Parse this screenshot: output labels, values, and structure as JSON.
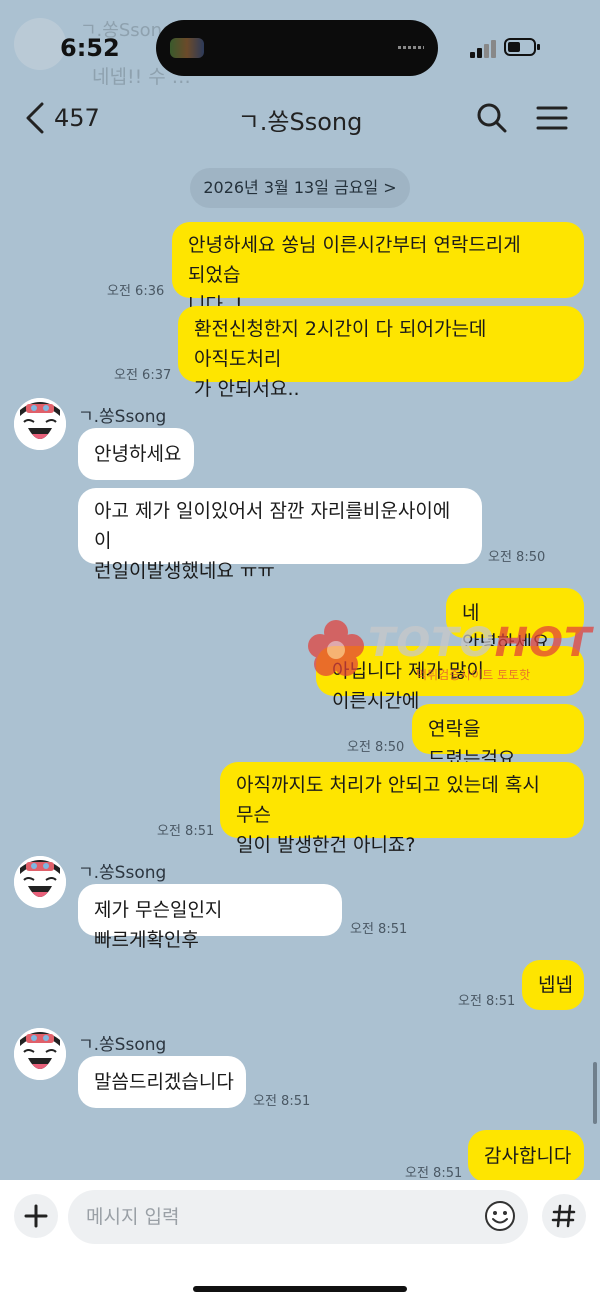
{
  "status": {
    "time": "6:52",
    "banner_sender": "ㄱ.쏭Ssong",
    "banner_preview": "네넵!! 수 …"
  },
  "header": {
    "unread_count": "457",
    "title": "ㄱ.쏭Ssong"
  },
  "date_chip": "2026년 3월 13일 금요일 >",
  "messages": [
    {
      "side": "me",
      "lines": [
        "안녕하세요 쏭님 이른시간부터 연락드리게 되었습",
        "니다..!"
      ],
      "time": "오전 6:36"
    },
    {
      "side": "me",
      "lines": [
        "환전신청한지 2시간이 다 되어가는데 아직도처리",
        "가 안되서요.."
      ],
      "time": "오전 6:37"
    },
    {
      "side": "them",
      "sender": "ㄱ.쏭Ssong",
      "lines": [
        "안녕하세요"
      ]
    },
    {
      "side": "them",
      "lines": [
        "아고  제가 일이있어서 잠깐 자리를비운사이에 이",
        "런일이발생했네요 ㅠㅠ"
      ],
      "time": "오전 8:50"
    },
    {
      "side": "me",
      "lines": [
        "네 안녕하세요"
      ]
    },
    {
      "side": "me",
      "lines": [
        "아닙니다 제가 많이 이른시간에"
      ]
    },
    {
      "side": "me",
      "lines": [
        "연락을 드렸는걸요"
      ],
      "time": "오전 8:50"
    },
    {
      "side": "me",
      "lines": [
        "아직까지도 처리가 안되고 있는데 혹시 무슨",
        "일이 발생한건 아니죠?"
      ],
      "time": "오전 8:51"
    },
    {
      "side": "them",
      "sender": "ㄱ.쏭Ssong",
      "lines": [
        "제가 무슨일인지 빠르게확인후"
      ],
      "time": "오전 8:51"
    },
    {
      "side": "me",
      "lines": [
        "넵넵"
      ],
      "time": "오전 8:51"
    },
    {
      "side": "them",
      "sender": "ㄱ.쏭Ssong",
      "lines": [
        "말씀드리겠습니다"
      ],
      "time": "오전 8:51"
    },
    {
      "side": "me",
      "lines": [
        "감사합니다"
      ],
      "time": "오전 8:51"
    }
  ],
  "watermark": {
    "brand_a": "TOTO",
    "brand_b": "HOT",
    "sub": "먹튀검증사이트 토토핫"
  },
  "input": {
    "placeholder": "메시지 입력"
  },
  "icons": {
    "back": "chevron-left-icon",
    "search": "search-icon",
    "menu": "hamburger-menu-icon",
    "plus": "plus-icon",
    "emoji": "smiley-icon",
    "hash": "hash-icon"
  },
  "colors": {
    "background": "#abc1d1",
    "my_bubble": "#fee500",
    "their_bubble": "#ffffff"
  }
}
